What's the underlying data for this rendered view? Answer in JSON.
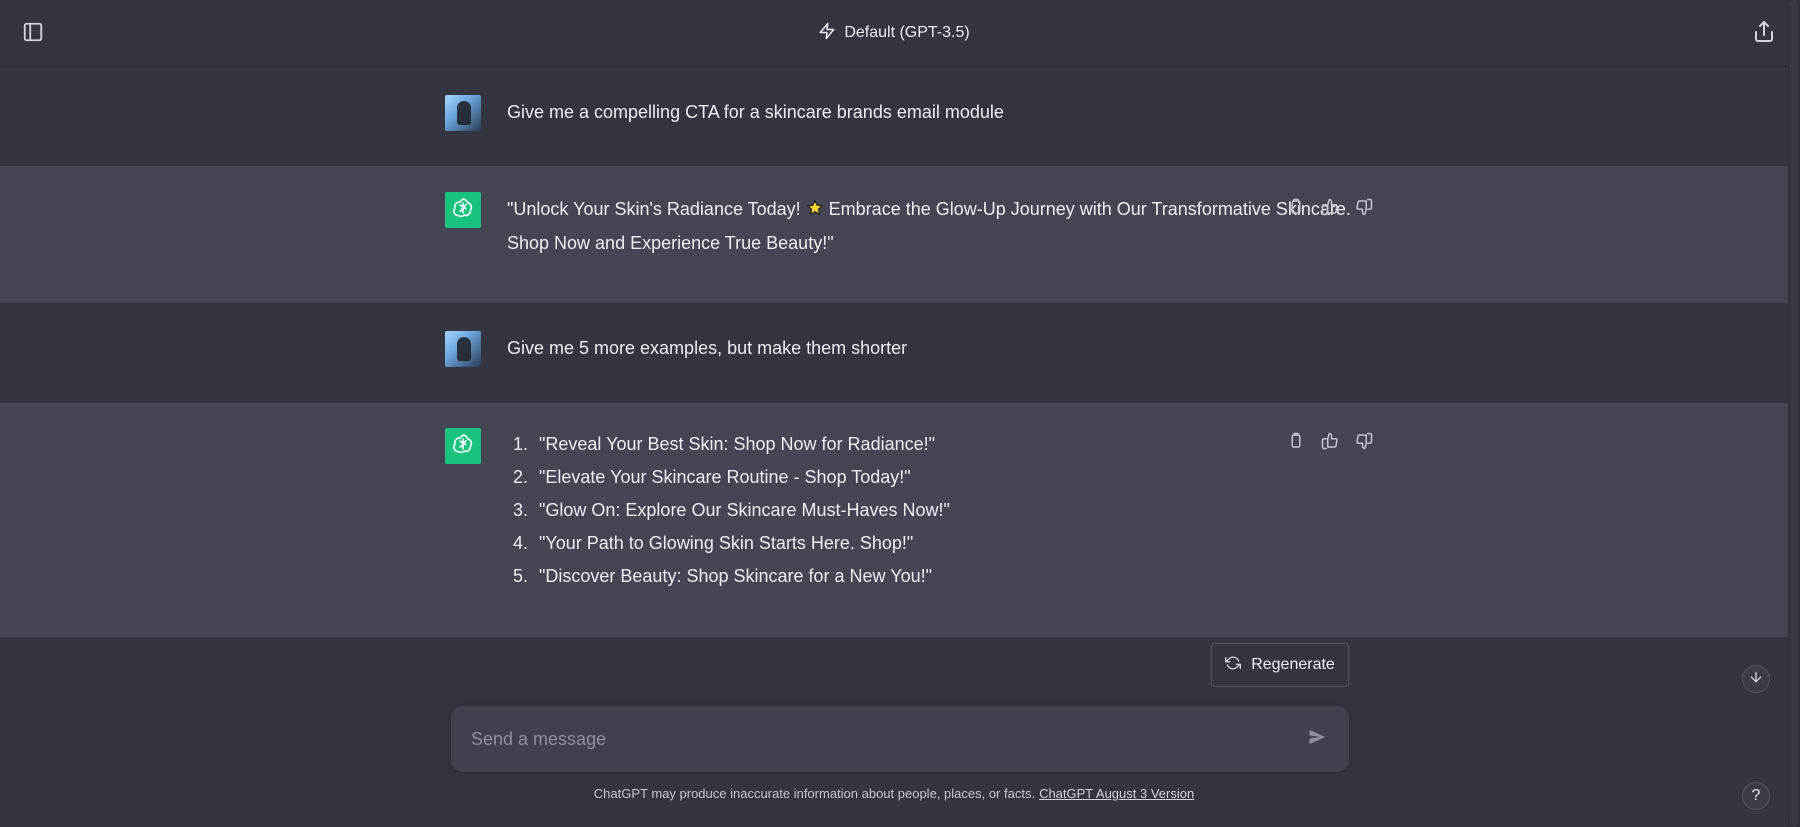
{
  "header": {
    "model_label": "Default (GPT-3.5)"
  },
  "conversation": [
    {
      "role": "user",
      "text": "Give me a compelling CTA for a skincare brands email module"
    },
    {
      "role": "assistant",
      "text_before_emoji": "\"Unlock Your Skin's Radiance Today! ",
      "emoji": "star",
      "text_after_emoji": " Embrace the Glow-Up Journey with Our Transformative Skincare. Shop Now and Experience True Beauty!\""
    },
    {
      "role": "user",
      "text": "Give me 5 more examples, but make them shorter"
    },
    {
      "role": "assistant",
      "list": [
        "\"Reveal Your Best Skin: Shop Now for Radiance!\"",
        "\"Elevate Your Skincare Routine - Shop Today!\"",
        "\"Glow On: Explore Our Skincare Must-Haves Now!\"",
        "\"Your Path to Glowing Skin Starts Here. Shop!\"",
        "\"Discover Beauty: Shop Skincare for a New You!\""
      ]
    }
  ],
  "actions": {
    "regenerate_label": "Regenerate"
  },
  "composer": {
    "placeholder": "Send a message"
  },
  "footer": {
    "disclaimer": "ChatGPT may produce inaccurate information about people, places, or facts.",
    "version_link": "ChatGPT August 3 Version"
  },
  "help": {
    "label": "?"
  },
  "icons": {
    "sidebar_toggle": "sidebar-toggle-icon",
    "share": "share-icon",
    "model_bolt": "lightning-bolt-icon",
    "copy": "clipboard-icon",
    "thumbs_up": "thumbs-up-icon",
    "thumbs_down": "thumbs-down-icon",
    "regenerate": "refresh-icon",
    "scroll_down": "arrow-down-icon",
    "send": "send-icon"
  },
  "colors": {
    "background": "#343541",
    "assistant_row": "#444654",
    "assistant_avatar": "#19c37d",
    "composer": "#40414f"
  }
}
